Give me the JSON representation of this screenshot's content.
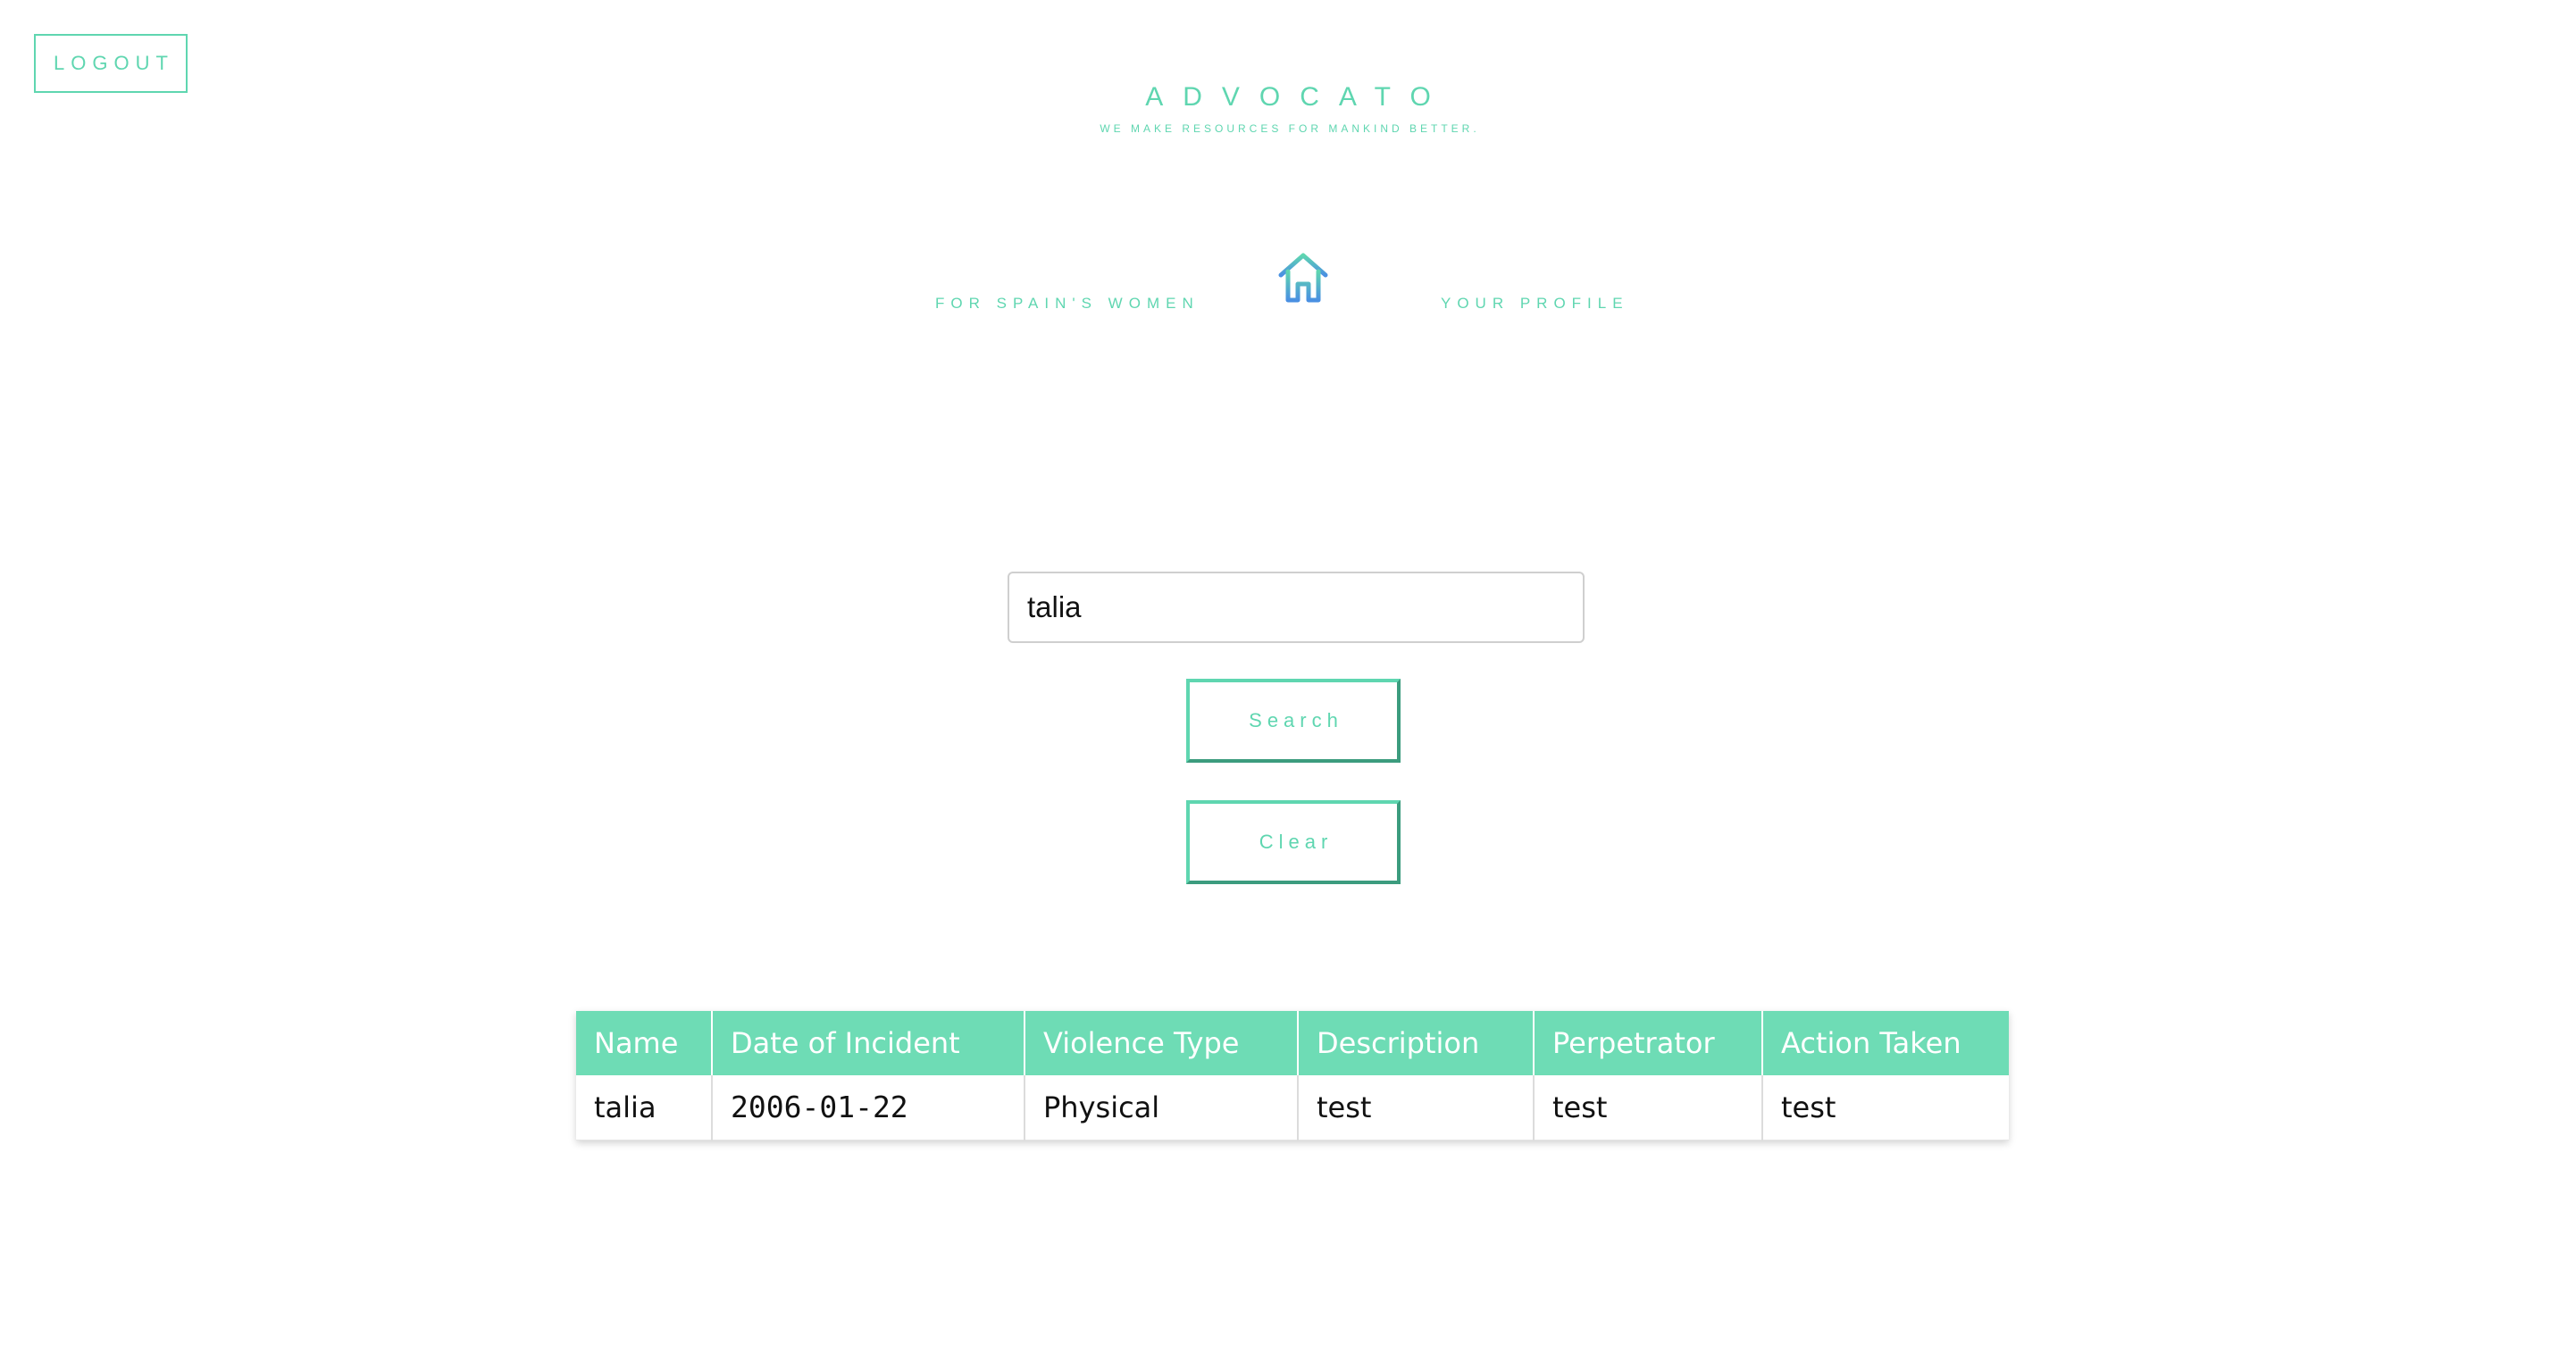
{
  "header": {
    "logout_label": "LOGOUT",
    "brand_title": "ADVOCATO",
    "brand_tagline": "WE MAKE RESOURCES FOR MANKIND BETTER."
  },
  "nav": {
    "left_link": "FOR SPAIN'S WOMEN",
    "home_icon": "home-icon",
    "right_link": "YOUR PROFILE"
  },
  "search": {
    "value": "talia",
    "search_label": "Search",
    "clear_label": "Clear"
  },
  "table": {
    "columns": [
      "Name",
      "Date of Incident",
      "Violence Type",
      "Description",
      "Perpetrator",
      "Action Taken"
    ],
    "rows": [
      [
        "talia",
        "2006-01-22",
        "Physical",
        "test",
        "test",
        "test"
      ]
    ]
  },
  "colors": {
    "accent": "#5fd6b0",
    "header_bg": "#6edcb5",
    "home_icon_top": "#5fd6b0",
    "home_icon_bottom": "#4a90e2"
  }
}
